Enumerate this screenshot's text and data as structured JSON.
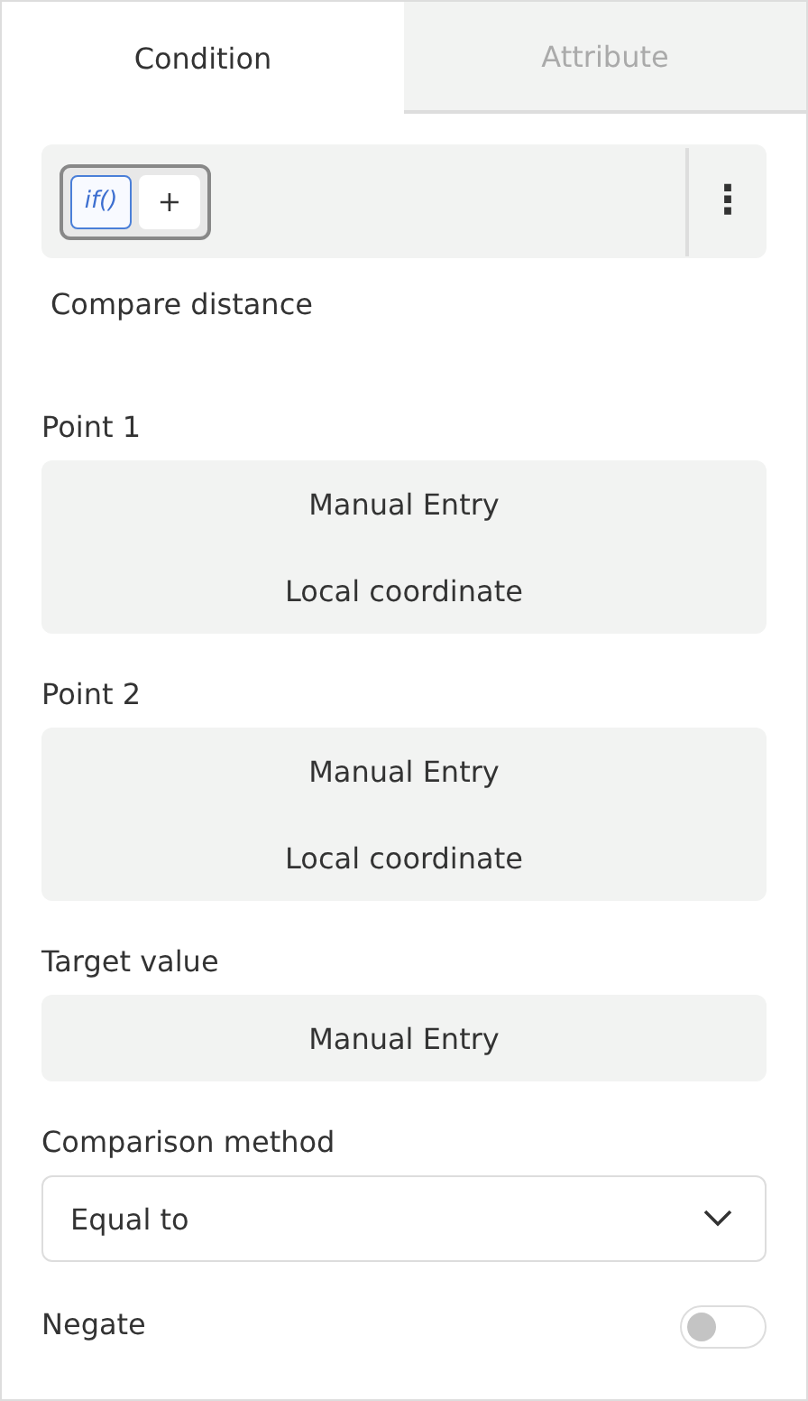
{
  "tabs": [
    {
      "label": "Condition",
      "selected": true
    },
    {
      "label": "Attribute",
      "selected": false
    }
  ],
  "toolbar": {
    "blocks": [
      {
        "label": "if()",
        "selected": true
      },
      {
        "label": "+",
        "selected": false
      }
    ],
    "menu": "⋮"
  },
  "description": "Compare distance",
  "fields": [
    {
      "kind": "options",
      "label": "Point 1",
      "options": [
        "Manual Entry",
        "Local coordinate"
      ]
    },
    {
      "kind": "options",
      "label": "Point 2",
      "options": [
        "Manual Entry",
        "Local coordinate"
      ]
    },
    {
      "kind": "options",
      "label": "Target value",
      "options": [
        "Manual Entry"
      ]
    },
    {
      "kind": "select",
      "label": "Comparison method",
      "value": "Equal to"
    },
    {
      "kind": "toggle",
      "label": "Negate",
      "on": false
    }
  ]
}
